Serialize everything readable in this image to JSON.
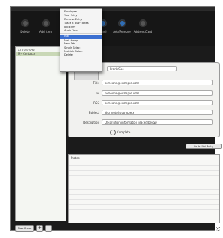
{
  "toolbar": {
    "buttons": [
      {
        "label": "Delete",
        "icon": "trash-icon"
      },
      {
        "label": "Add Item",
        "icon": "plus-icon"
      },
      {
        "label": "Search",
        "icon": "magnifier-icon"
      },
      {
        "label": "Add/Remove",
        "icon": "people-icon"
      },
      {
        "label": "Address Card",
        "icon": "card-icon"
      }
    ]
  },
  "sidebar": {
    "items": [
      "All Contacts",
      "My Contacts"
    ],
    "selected": 1,
    "bottom_button": "New Group",
    "add_label": "+",
    "remove_label": "-"
  },
  "menu": {
    "items": [
      "Employee",
      "Your Entry",
      "Remove Entry",
      "Tasks & Busy dates",
      "Job Entry",
      "Audio Tour",
      "Mail",
      "Mail Group",
      "New Tab",
      "Single Select",
      "Multiple Select",
      "Delete"
    ],
    "highlighted": 6
  },
  "detail": {
    "name_value": "Frank Spe",
    "fields": [
      {
        "label": "Title",
        "value": "someone@example.com"
      },
      {
        "label": "To",
        "value": "someone@example.com"
      },
      {
        "label": "RSS",
        "value": "someone@example.com"
      },
      {
        "label": "Subject",
        "value": "Your note is complete"
      },
      {
        "label": "Description",
        "value": "Description information placed below"
      }
    ],
    "complete_label": "Complete"
  },
  "action_button": "Go to Mail Entry",
  "notes": {
    "label": "Notes"
  },
  "colors": {
    "window_bg": "#1b1b1b",
    "toolbar_bg": "#161616",
    "menu_highlight": "#3b6fd1"
  }
}
